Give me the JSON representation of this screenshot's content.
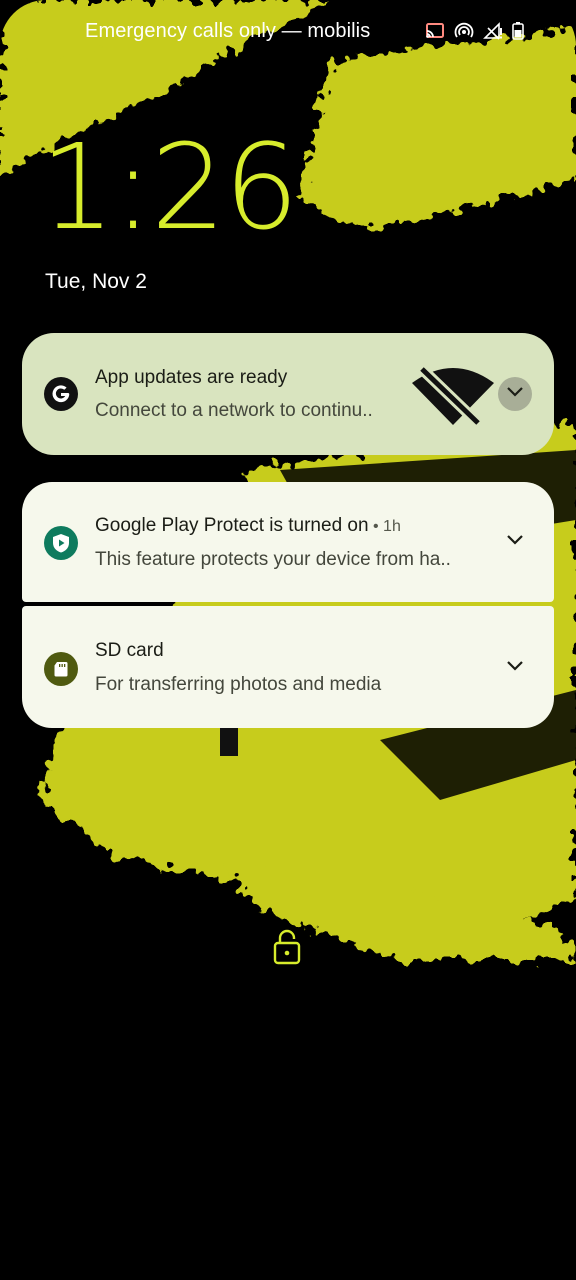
{
  "status_bar": {
    "carrier": "Emergency calls only — mobilis",
    "icons": [
      "cast-icon",
      "hotspot-icon",
      "signal-off-icon",
      "battery-icon"
    ]
  },
  "lockscreen": {
    "time": "1:26",
    "date": "Tue, Nov 2",
    "accent_color": "#d7ec2c"
  },
  "notifications": [
    {
      "icon": "google-g-icon",
      "title": "App updates are ready",
      "text": "Connect to a network to continu..",
      "extra_icon": "wifi-off-icon",
      "background": "#d9e4bf"
    },
    {
      "icon": "play-protect-icon",
      "title": "Google Play Protect is turned on",
      "meta": " • 1h",
      "text": "This feature protects your device from ha..",
      "background": "#f6f8ec"
    },
    {
      "icon": "sd-card-icon",
      "title": "SD card",
      "text": "For transferring photos and media",
      "background": "#f6f8ec"
    }
  ],
  "bottom": {
    "icon": "lock-icon"
  }
}
